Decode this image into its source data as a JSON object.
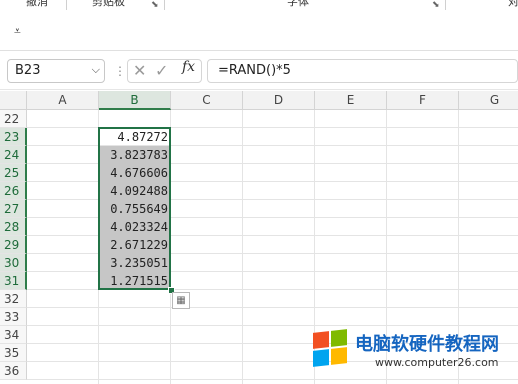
{
  "ribbon": {
    "groups": [
      "撤消",
      "剪贴板",
      "字体",
      "对"
    ],
    "quick_access_icon": "customize-toolbar-icon"
  },
  "formula_bar": {
    "name_box": "B23",
    "formula": "=RAND()*5",
    "fx_label": "fx"
  },
  "columns": [
    "A",
    "B",
    "C",
    "D",
    "E",
    "F",
    "G"
  ],
  "selected_column": "B",
  "rows": [
    "22",
    "23",
    "24",
    "25",
    "26",
    "27",
    "28",
    "29",
    "30",
    "31",
    "32",
    "33",
    "34",
    "35",
    "36"
  ],
  "cells_b": [
    {
      "row": "23",
      "value": "4.87272"
    },
    {
      "row": "24",
      "value": "3.823783"
    },
    {
      "row": "25",
      "value": "4.676606"
    },
    {
      "row": "26",
      "value": "4.092488"
    },
    {
      "row": "27",
      "value": "0.755649"
    },
    {
      "row": "28",
      "value": "4.023324"
    },
    {
      "row": "29",
      "value": "2.671229"
    },
    {
      "row": "30",
      "value": "3.235051"
    },
    {
      "row": "31",
      "value": "1.271515"
    }
  ],
  "watermark": {
    "title": "电脑软硬件教程网",
    "url": "www.computer26.com"
  },
  "colors": {
    "selection": "#217346",
    "highlight": "#c6c6c6",
    "watermark_blue": "#1565c0"
  }
}
